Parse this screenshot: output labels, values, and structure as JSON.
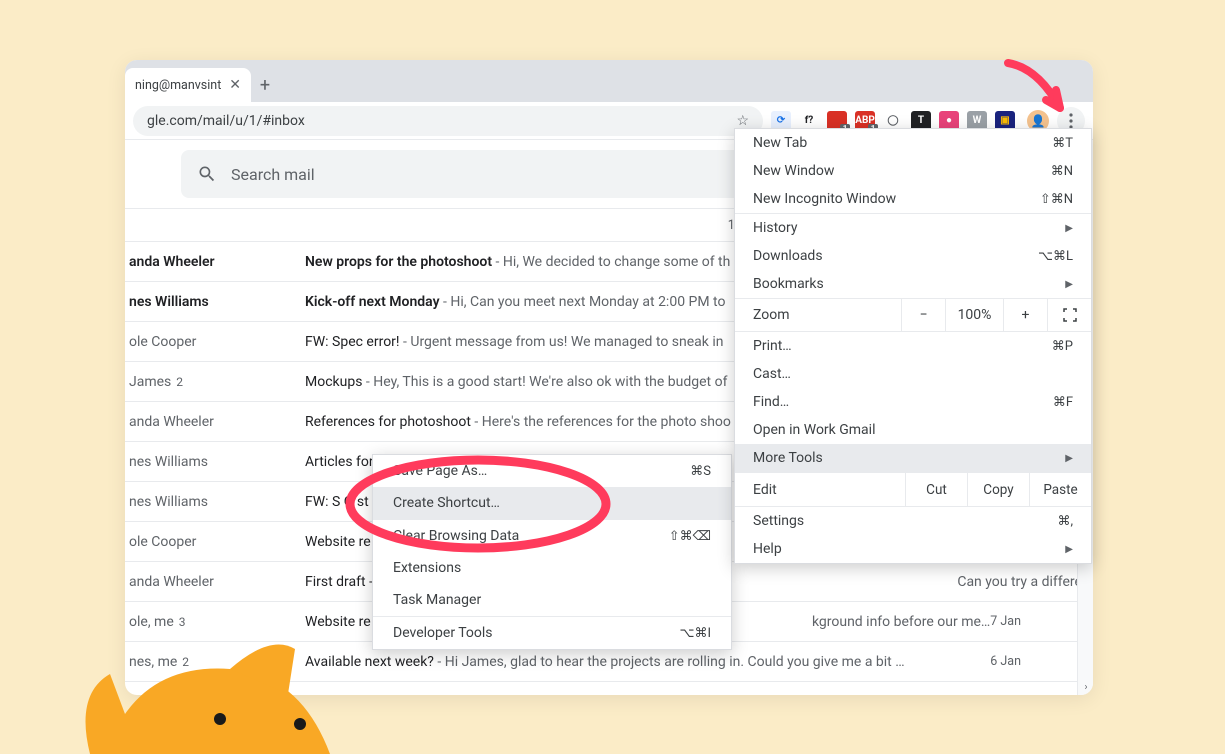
{
  "browser": {
    "tab_title": "ning@manvsint",
    "url": "gle.com/mail/u/1/#inbox",
    "extensions": [
      {
        "name": "translate-icon",
        "bg": "#e8f0fe",
        "txt": "⟳",
        "fg": "#1a73e8"
      },
      {
        "name": "whatfont-icon",
        "bg": "#fff",
        "txt": "f?",
        "fg": "#202124"
      },
      {
        "name": "ext-red-1",
        "bg": "#d93025",
        "txt": "",
        "badge": "1"
      },
      {
        "name": "adblock-icon",
        "bg": "#d93025",
        "txt": "ABP",
        "fg": "#fff",
        "badge": "1"
      },
      {
        "name": "ext-circle",
        "bg": "#fff",
        "txt": "◯",
        "fg": "#5f6368"
      },
      {
        "name": "ext-dark",
        "bg": "#202124",
        "txt": "T",
        "fg": "#fff"
      },
      {
        "name": "ext-pink",
        "bg": "#e8437a",
        "txt": "●",
        "fg": "#fff"
      },
      {
        "name": "ext-w",
        "bg": "#9aa0a6",
        "txt": "W",
        "fg": "#fff"
      },
      {
        "name": "ext-blue",
        "bg": "#1a237e",
        "txt": "▣",
        "fg": "#fbbc04"
      }
    ]
  },
  "search": {
    "placeholder": "Search mail"
  },
  "pagination": "1–",
  "emails": [
    {
      "sender": "anda Wheeler",
      "subject": "New props for the photoshoot",
      "snippet": " - Hi, We decided to change some of th",
      "unread": true
    },
    {
      "sender": "nes Williams",
      "subject": "Kick-off next Monday",
      "snippet": " - Hi, Can you meet next Monday at 2:00 PM to",
      "unread": true
    },
    {
      "sender": "ole Cooper",
      "subject": "FW: Spec error!",
      "snippet": " - Urgent message from us! We managed to sneak in",
      "unread": false
    },
    {
      "sender": "James",
      "count": "2",
      "subject": "Mockups",
      "snippet": " - Hey, This is a good start! We're also ok with the budget of",
      "unread": false
    },
    {
      "sender": "anda Wheeler",
      "subject": "References for photoshoot",
      "snippet": " - Here's the references for the photo shoo",
      "unread": false
    },
    {
      "sender": "nes Williams",
      "subject": "Articles for",
      "unread": false
    },
    {
      "sender": "nes Williams",
      "subject": "FW: S    O st",
      "unread": false
    },
    {
      "sender": "ole Cooper",
      "subject": "Website re",
      "unread": false
    },
    {
      "sender": "anda Wheeler",
      "subject": "First draft -",
      "snippet": "",
      "unread": false,
      "tail": "Can you try a differe..."
    },
    {
      "sender": "ole, me",
      "count": "3",
      "subject": "Website re",
      "snippet": "",
      "tail": "kground info before our me…",
      "date": "7 Jan",
      "unread": false
    },
    {
      "sender": "nes, me",
      "count": "2",
      "subject": "Available next week?",
      "snippet": " - Hi James, glad to hear the projects are rolling in. Could you give me a bit …",
      "date": "6 Jan",
      "unread": false
    }
  ],
  "menu": {
    "new_tab": "New Tab",
    "new_tab_sc": "⌘T",
    "new_window": "New Window",
    "new_window_sc": "⌘N",
    "new_incognito": "New Incognito Window",
    "new_incognito_sc": "⇧⌘N",
    "history": "History",
    "downloads": "Downloads",
    "downloads_sc": "⌥⌘L",
    "bookmarks": "Bookmarks",
    "zoom": "Zoom",
    "zoom_pct": "100%",
    "print": "Print…",
    "print_sc": "⌘P",
    "cast": "Cast…",
    "find": "Find…",
    "find_sc": "⌘F",
    "open_in": "Open in Work Gmail",
    "more_tools": "More Tools",
    "edit": "Edit",
    "cut": "Cut",
    "copy": "Copy",
    "paste": "Paste",
    "settings": "Settings",
    "settings_sc": "⌘,",
    "help": "Help"
  },
  "submenu": {
    "save_page": "Save Page As…",
    "save_page_sc": "⌘S",
    "create_shortcut": "Create Shortcut…",
    "clear_browsing": "Clear Browsing Data",
    "clear_browsing_sc": "⇧⌘⌫",
    "extensions": "Extensions",
    "task_manager": "Task Manager",
    "dev_tools": "Developer Tools",
    "dev_tools_sc": "⌥⌘I"
  }
}
